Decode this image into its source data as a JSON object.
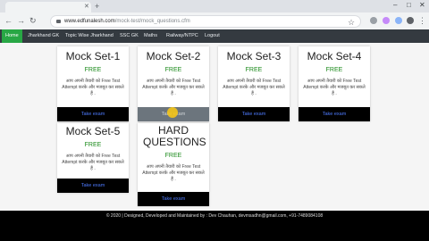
{
  "browser": {
    "url_host": "www.edfunalesh.com",
    "url_path": "/mock-test/mock_questions.cfm"
  },
  "nav": {
    "items": [
      "Home",
      "Jharkhand GK",
      "Topic Wise Jharkhand",
      "SSC GK",
      "Maths",
      "Railway/NTPC",
      "Logout"
    ],
    "active": "Home"
  },
  "cards": [
    {
      "title": "Mock Set-1",
      "free": "FREE",
      "desc": "आप अपनी तैयारी को Free Test Attempt करके और मजबूत कर सकते हैं .",
      "button": "Take exam"
    },
    {
      "title": "Mock Set-2",
      "free": "FREE",
      "desc": "आप अपनी तैयारी को Free Test Attempt करके और मजबूत कर सकते हैं .",
      "button": "Take exam"
    },
    {
      "title": "Mock Set-3",
      "free": "FREE",
      "desc": "आप अपनी तैयारी को Free Test Attempt करके और मजबूत कर सकते हैं .",
      "button": "Take exam"
    },
    {
      "title": "Mock Set-4",
      "free": "FREE",
      "desc": "आप अपनी तैयारी को Free Test Attempt करके और मजबूत कर सकते हैं .",
      "button": "Take exam"
    },
    {
      "title": "Mock Set-5",
      "free": "FREE",
      "desc": "आप अपनी तैयारी को Free Test Attempt करके और मजबूत कर सकते हैं .",
      "button": "Take exam"
    },
    {
      "title": "HARD QUESTIONS",
      "free": "FREE",
      "desc": "आप अपनी तैयारी को Free Test Attempt करके और मजबूत कर सकते हैं .",
      "button": "Take exam"
    }
  ],
  "footer": {
    "text": "© 2020 | Designed, Developed and Maintained by : Dev Chauhan, devmsadhn@gmail.com, +91-7489084108"
  },
  "colors": {
    "nav_bg": "#343a40",
    "nav_active": "#28a745",
    "free_text": "#1b8a1b",
    "button_text": "#4e7bff"
  }
}
